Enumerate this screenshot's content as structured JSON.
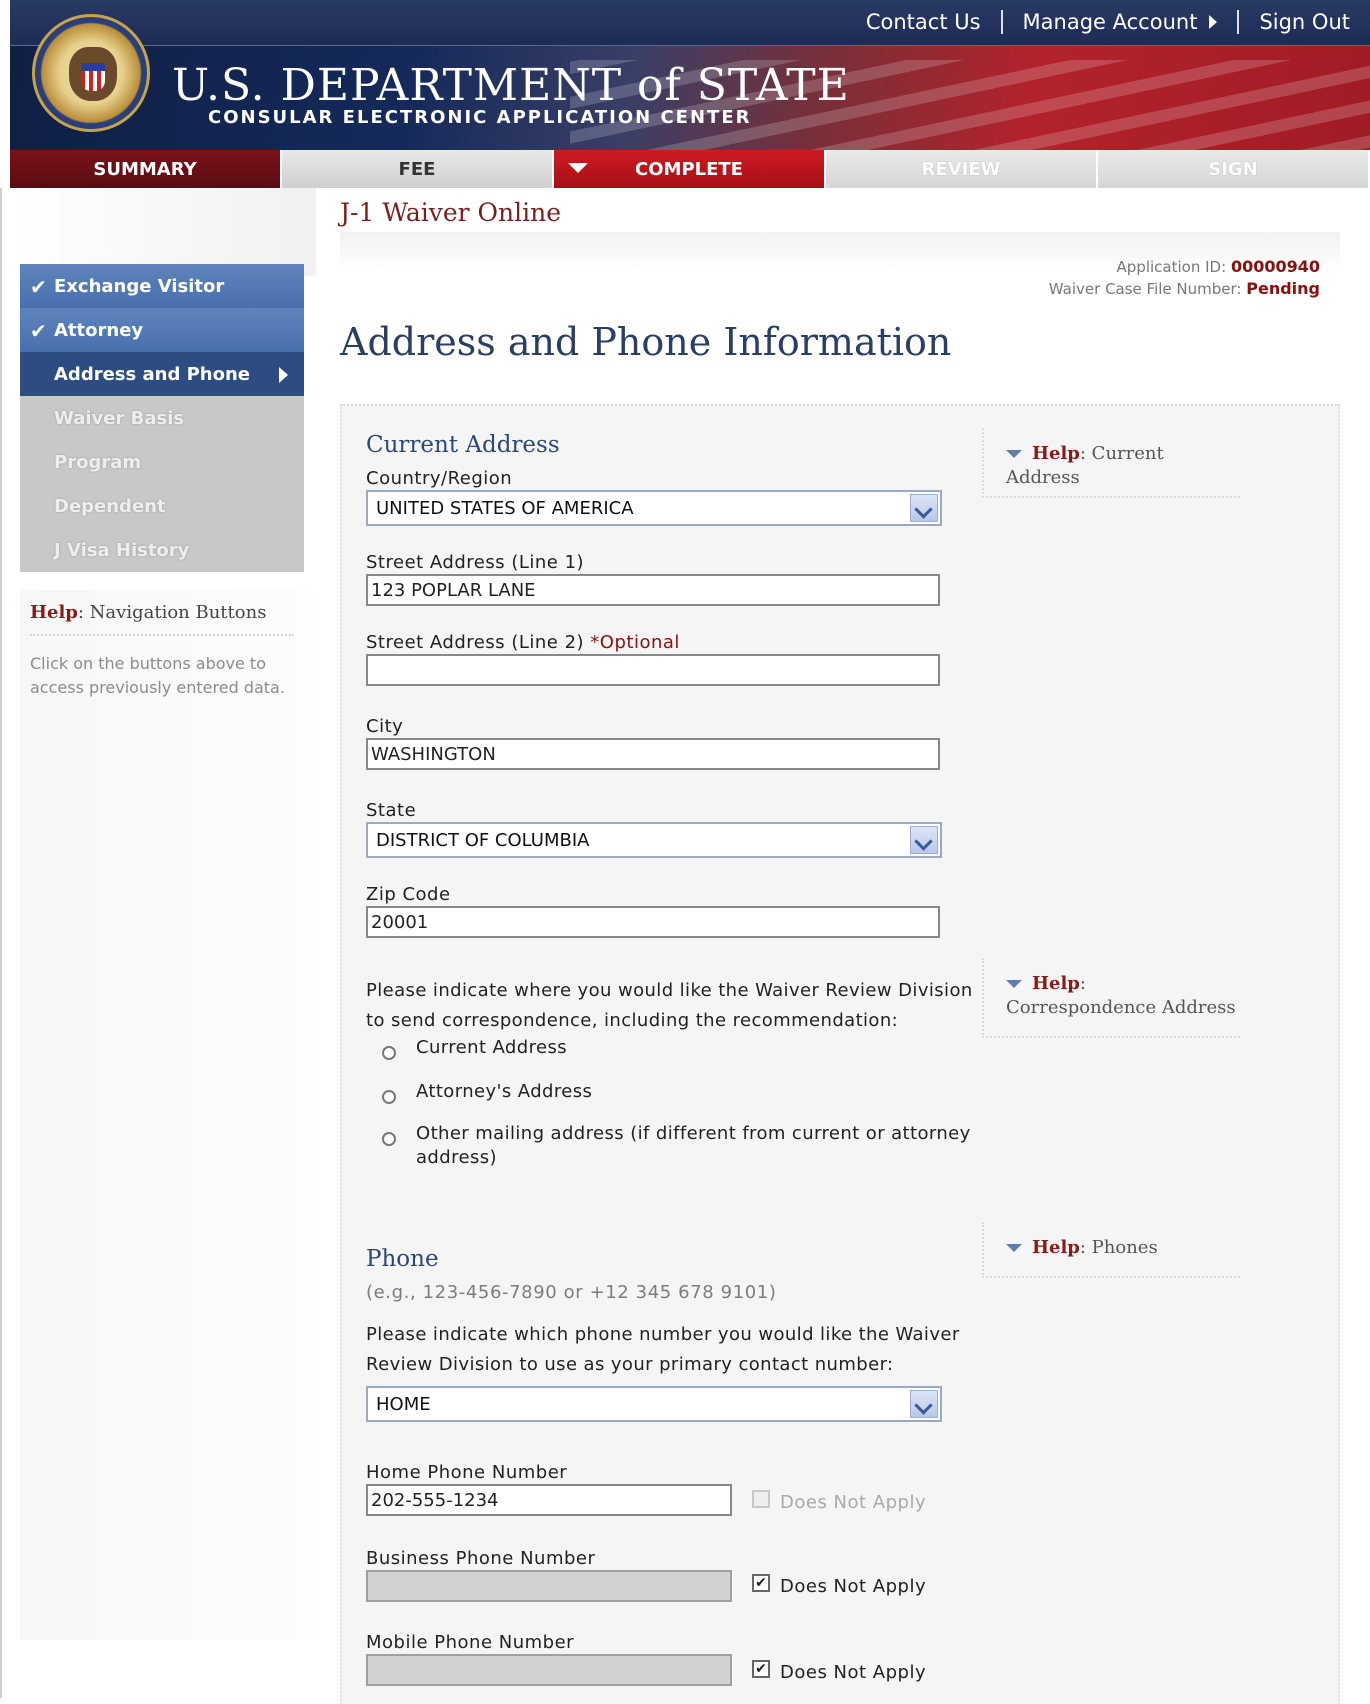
{
  "header": {
    "links": [
      "Contact Us",
      "Manage Account",
      "Sign Out"
    ],
    "title": "U.S. DEPARTMENT of STATE",
    "subtitle": "CONSULAR ELECTRONIC APPLICATION CENTER"
  },
  "steps": [
    "SUMMARY",
    "FEE",
    "COMPLETE",
    "REVIEW",
    "SIGN"
  ],
  "sidebar": {
    "items": [
      {
        "label": "Exchange Visitor",
        "state": "done"
      },
      {
        "label": "Attorney",
        "state": "done"
      },
      {
        "label": "Address and Phone",
        "state": "current"
      },
      {
        "label": "Waiver Basis",
        "state": "disabled"
      },
      {
        "label": "Program",
        "state": "disabled"
      },
      {
        "label": "Dependent",
        "state": "disabled"
      },
      {
        "label": "J Visa History",
        "state": "disabled"
      }
    ],
    "help": {
      "prefix": "Help",
      "title": ": Navigation Buttons",
      "text": "Click on the buttons above to access previously entered data."
    }
  },
  "main": {
    "app_title": "J-1 Waiver Online",
    "app_id_label": "Application ID:",
    "app_id": "00000940",
    "case_label": "Waiver Case File Number:",
    "case_value": "Pending",
    "page_title": "Address and Phone Information"
  },
  "current_address": {
    "title": "Current Address",
    "country_label": "Country/Region",
    "country_value": "UNITED STATES OF AMERICA",
    "street1_label": "Street Address (Line 1)",
    "street1_value": "123 POPLAR LANE",
    "street2_label": "Street Address (Line 2)",
    "optional_label": "*Optional",
    "street2_value": "",
    "city_label": "City",
    "city_value": "WASHINGTON",
    "state_label": "State",
    "state_value": "DISTRICT OF COLUMBIA",
    "zip_label": "Zip Code",
    "zip_value": "20001"
  },
  "correspondence": {
    "prompt_line1": "Please indicate where you would like the Waiver Review Division",
    "prompt_line2": "to send correspondence, including the recommendation:",
    "options": [
      "Current Address",
      "Attorney's Address",
      "Other mailing address (if different from current or attorney address)"
    ]
  },
  "phone": {
    "title": "Phone",
    "hint": "(e.g., 123-456-7890 or +12 345 678 9101)",
    "prompt_line1": "Please indicate which phone number you would like the Waiver",
    "prompt_line2": "Review Division to use as your primary contact number:",
    "primary_value": "HOME",
    "home_label": "Home Phone Number",
    "home_value": "202-555-1234",
    "business_label": "Business Phone Number",
    "business_value": "",
    "mobile_label": "Mobile Phone Number",
    "mobile_value": "",
    "dna_label": "Does Not Apply"
  },
  "help_panels": {
    "prefix": "Help",
    "current_address": ": Current Address",
    "correspondence": ": Correspondence Address",
    "phones": ": Phones"
  },
  "colors": {
    "accent_red": "#8a1010",
    "nav_blue": "#4870ad",
    "nav_dark": "#2d4d82",
    "title_blue": "#2a3f63"
  }
}
